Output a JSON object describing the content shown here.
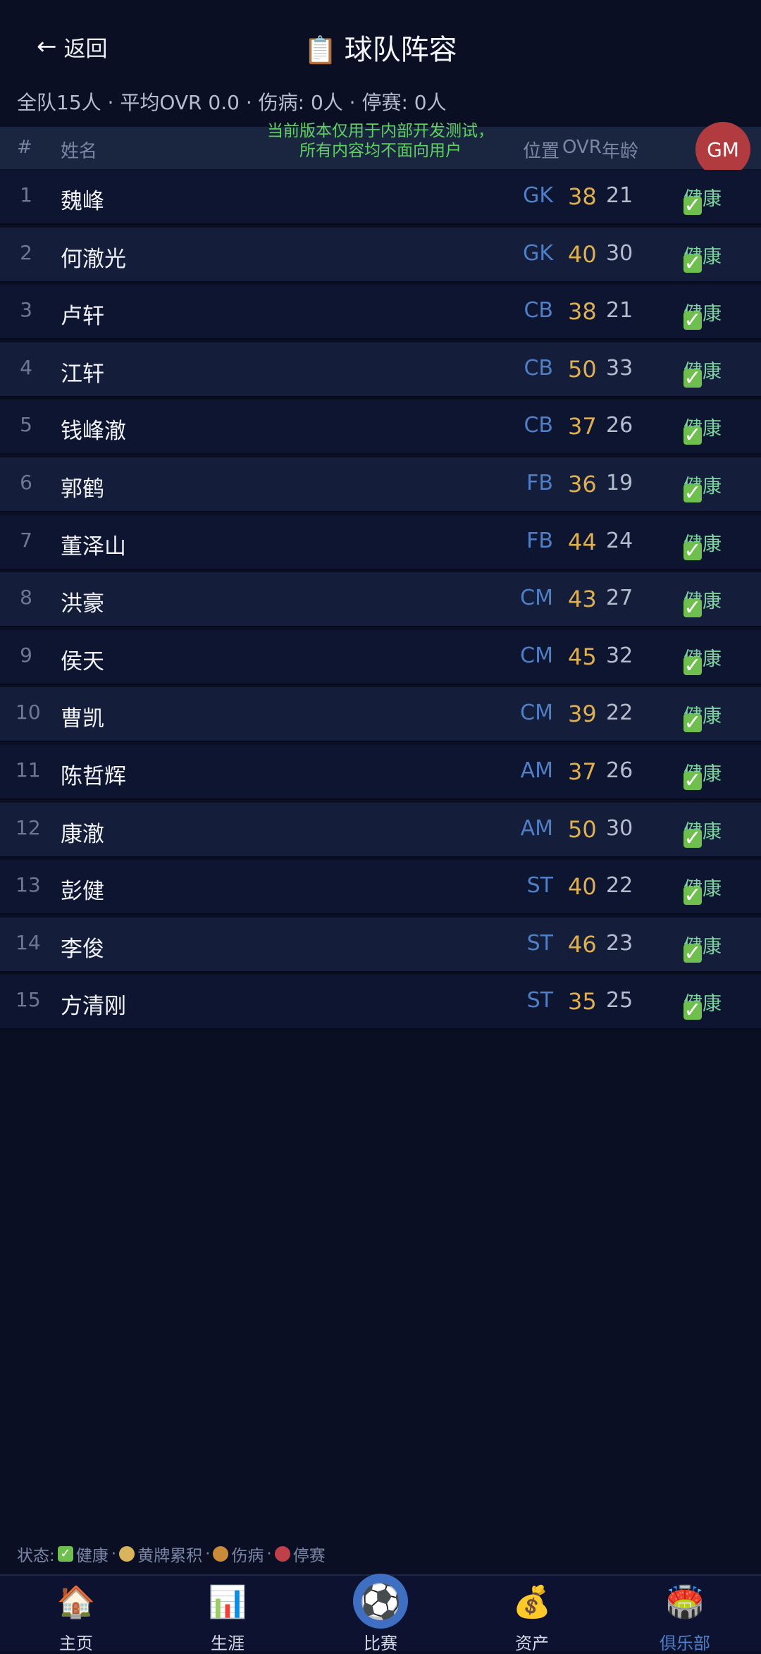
{
  "header": {
    "back_label": "返回",
    "title": "球队阵容",
    "summary": "全队15人 · 平均OVR 0.0 · 伤病: 0人 · 停赛: 0人"
  },
  "table_header": {
    "num": "#",
    "name": "姓名",
    "pos": "位置",
    "ovr": "OVR",
    "age": "年龄"
  },
  "notice": {
    "line1": "当前版本仅用于内部开发测试，",
    "line2": "所有内容均不面向用户"
  },
  "gm_label": "GM",
  "players": [
    {
      "num": "1",
      "name": "魏峰",
      "pos": "GK",
      "ovr": "38",
      "age": "21",
      "status": "健康"
    },
    {
      "num": "2",
      "name": "何澈光",
      "pos": "GK",
      "ovr": "40",
      "age": "30",
      "status": "健康"
    },
    {
      "num": "3",
      "name": "卢轩",
      "pos": "CB",
      "ovr": "38",
      "age": "21",
      "status": "健康"
    },
    {
      "num": "4",
      "name": "江轩",
      "pos": "CB",
      "ovr": "50",
      "age": "33",
      "status": "健康"
    },
    {
      "num": "5",
      "name": "钱峰澈",
      "pos": "CB",
      "ovr": "37",
      "age": "26",
      "status": "健康"
    },
    {
      "num": "6",
      "name": "郭鹤",
      "pos": "FB",
      "ovr": "36",
      "age": "19",
      "status": "健康"
    },
    {
      "num": "7",
      "name": "董泽山",
      "pos": "FB",
      "ovr": "44",
      "age": "24",
      "status": "健康"
    },
    {
      "num": "8",
      "name": "洪豪",
      "pos": "CM",
      "ovr": "43",
      "age": "27",
      "status": "健康"
    },
    {
      "num": "9",
      "name": "侯天",
      "pos": "CM",
      "ovr": "45",
      "age": "32",
      "status": "健康"
    },
    {
      "num": "10",
      "name": "曹凯",
      "pos": "CM",
      "ovr": "39",
      "age": "22",
      "status": "健康"
    },
    {
      "num": "11",
      "name": "陈哲辉",
      "pos": "AM",
      "ovr": "37",
      "age": "26",
      "status": "健康"
    },
    {
      "num": "12",
      "name": "康澈",
      "pos": "AM",
      "ovr": "50",
      "age": "30",
      "status": "健康"
    },
    {
      "num": "13",
      "name": "彭健",
      "pos": "ST",
      "ovr": "40",
      "age": "22",
      "status": "健康"
    },
    {
      "num": "14",
      "name": "李俊",
      "pos": "ST",
      "ovr": "46",
      "age": "23",
      "status": "健康"
    },
    {
      "num": "15",
      "name": "方清刚",
      "pos": "ST",
      "ovr": "35",
      "age": "25",
      "status": "健康"
    }
  ],
  "legend": {
    "prefix": "状态:",
    "healthy": "健康",
    "yellow": "黄牌累积",
    "injury": "伤病",
    "suspended": "停赛",
    "sep": "·",
    "colors": {
      "yellow": "#d9b45a",
      "injury": "#c98a3a",
      "suspended": "#c0404a"
    }
  },
  "nav": [
    {
      "label": "主页",
      "icon": "house-icon"
    },
    {
      "label": "生涯",
      "icon": "bar-chart-icon"
    },
    {
      "label": "比赛",
      "icon": "soccer-ball-icon"
    },
    {
      "label": "资产",
      "icon": "money-bag-icon"
    },
    {
      "label": "俱乐部",
      "icon": "stadium-icon"
    }
  ],
  "colors": {
    "background": "#0a0f24",
    "accent": "#4f7fc7",
    "ovr": "#e0b04e",
    "status": "#7dd3a0",
    "gm": "#b13b3f"
  }
}
